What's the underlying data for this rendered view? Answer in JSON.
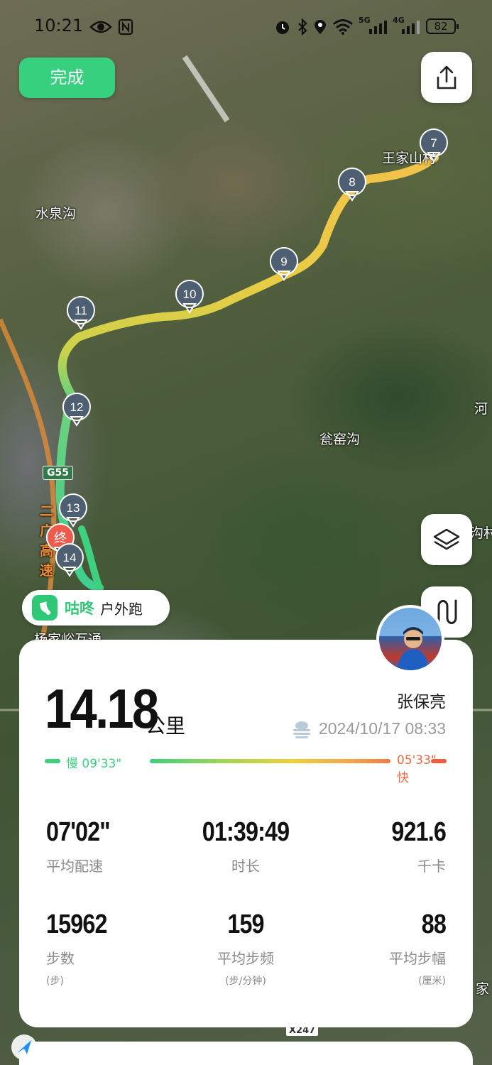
{
  "status_bar": {
    "time": "10:21",
    "battery": "82",
    "network_1": "5G",
    "network_2": "4G"
  },
  "top": {
    "done_label": "完成"
  },
  "map": {
    "place_labels": [
      {
        "name": "label-wangjiashancun",
        "text": "王家山村"
      },
      {
        "name": "label-shuiquangou",
        "text": "水泉沟"
      },
      {
        "name": "label-wengyaogou",
        "text": "瓮窑沟"
      },
      {
        "name": "label-yangjiayu",
        "text": "杨家峪互通"
      },
      {
        "name": "label-he-partial",
        "text": "河"
      },
      {
        "name": "label-gou-partial",
        "text": "沟村"
      },
      {
        "name": "label-jia-partial",
        "text": "家"
      },
      {
        "name": "label-erguang",
        "text": "二广高速"
      }
    ],
    "road_shields": {
      "g55": "G55",
      "x247": "X247"
    },
    "km_markers": [
      "7",
      "8",
      "9",
      "10",
      "11",
      "12",
      "13",
      "14"
    ],
    "end_marker": "终"
  },
  "app_badge": {
    "name": "咕咚",
    "activity": "户外跑"
  },
  "record": {
    "distance": "14.18",
    "distance_unit": "公里",
    "user_name": "张保亮",
    "datetime": "2024/10/17 08:33",
    "pace_slow": "慢 09'33\"",
    "pace_fast": "05'33\" 快",
    "weather_icon": "cloudy-icon"
  },
  "metrics": [
    {
      "value": "07'02\"",
      "label": "平均配速",
      "sub": ""
    },
    {
      "value": "01:39:49",
      "label": "时长",
      "sub": ""
    },
    {
      "value": "921.6",
      "label": "千卡",
      "sub": ""
    },
    {
      "value": "15962",
      "label": "步数",
      "sub": "(步)"
    },
    {
      "value": "159",
      "label": "平均步频",
      "sub": "(步/分钟)"
    },
    {
      "value": "88",
      "label": "平均步幅",
      "sub": "(厘米)"
    }
  ],
  "colors": {
    "accent_green": "#36d07e",
    "slow_color": "#3ecf7f",
    "fast_color": "#ee5d3e"
  }
}
